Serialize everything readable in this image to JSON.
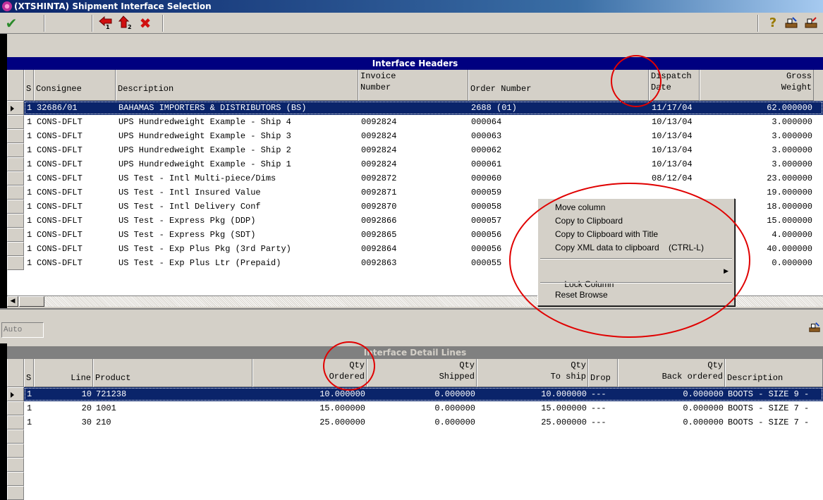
{
  "window": {
    "title": "(XTSHINTA)  Shipment Interface Selection"
  },
  "toolbar": {
    "icons": [
      "checkmark-icon",
      "prev-arrow-icon",
      "up-arrow-icon",
      "close-x-icon",
      "help-icon",
      "export-icon",
      "export2-icon"
    ],
    "prev_label": "1",
    "up_label": "2"
  },
  "headers_grid": {
    "title": "Interface Headers",
    "columns": [
      "S",
      "Consignee",
      "Description",
      "Invoice\nNumber",
      "Order Number",
      "Dispatch\nDate",
      "Gross\nWeight"
    ],
    "rows": [
      [
        "1",
        "32686/01",
        "BAHAMAS IMPORTERS & DISTRIBUTORS (BS)",
        "",
        "2688 (01)",
        "11/17/04",
        "62.000000"
      ],
      [
        "1",
        "CONS-DFLT",
        "UPS Hundredweight Example - Ship 4",
        "0092824",
        "000064",
        "10/13/04",
        "3.000000"
      ],
      [
        "1",
        "CONS-DFLT",
        "UPS Hundredweight Example - Ship 3",
        "0092824",
        "000063",
        "10/13/04",
        "3.000000"
      ],
      [
        "1",
        "CONS-DFLT",
        "UPS Hundredweight Example - Ship 2",
        "0092824",
        "000062",
        "10/13/04",
        "3.000000"
      ],
      [
        "1",
        "CONS-DFLT",
        "UPS Hundredweight Example - Ship 1",
        "0092824",
        "000061",
        "10/13/04",
        "3.000000"
      ],
      [
        "1",
        "CONS-DFLT",
        "US Test - Intl Multi-piece/Dims",
        "0092872",
        "000060",
        "08/12/04",
        "23.000000"
      ],
      [
        "1",
        "CONS-DFLT",
        "US Test - Intl Insured Value",
        "0092871",
        "000059",
        "",
        "19.000000"
      ],
      [
        "1",
        "CONS-DFLT",
        "US Test - Intl Delivery Conf",
        "0092870",
        "000058",
        "",
        "18.000000"
      ],
      [
        "1",
        "CONS-DFLT",
        "US Test - Express Pkg (DDP)",
        "0092866",
        "000057",
        "",
        "15.000000"
      ],
      [
        "1",
        "CONS-DFLT",
        "US Test - Express Pkg (SDT)",
        "0092865",
        "000056",
        "",
        "4.000000"
      ],
      [
        "1",
        "CONS-DFLT",
        "US Test - Exp Plus Pkg (3rd Party)",
        "0092864",
        "000056",
        "",
        "40.000000"
      ],
      [
        "1",
        "CONS-DFLT",
        "US Test - Exp Plus Ltr (Prepaid)",
        "0092863",
        "000055",
        "",
        "0.000000"
      ]
    ]
  },
  "auto_field": {
    "placeholder": "Auto"
  },
  "detail_grid": {
    "title": "Interface Detail Lines",
    "columns": [
      "S",
      "Line",
      "Product",
      "Qty\nOrdered",
      "Qty\nShipped",
      "Qty\nTo ship",
      "Drop",
      "Qty\nBack ordered",
      "Description"
    ],
    "rows": [
      [
        "1",
        "10",
        "721238",
        "10.000000",
        "0.000000",
        "10.000000",
        "---",
        "0.000000",
        "BOOTS - SIZE 9 -"
      ],
      [
        "1",
        "20",
        "1001",
        "15.000000",
        "0.000000",
        "15.000000",
        "---",
        "0.000000",
        "BOOTS - SIZE 7 -"
      ],
      [
        "1",
        "30",
        "210",
        "25.000000",
        "0.000000",
        "25.000000",
        "---",
        "0.000000",
        "BOOTS - SIZE 7 -"
      ]
    ]
  },
  "context_menu": {
    "items": [
      "Move column",
      "Copy to Clipboard",
      "Copy to Clipboard with Title",
      "Copy XML data to clipboard    (CTRL-L)",
      "Lock Column",
      "Reset Browse"
    ]
  },
  "colors": {
    "selection": "#0a246a",
    "annotation": "#e00000",
    "title_active": "#000080",
    "title_inactive": "#808080"
  }
}
